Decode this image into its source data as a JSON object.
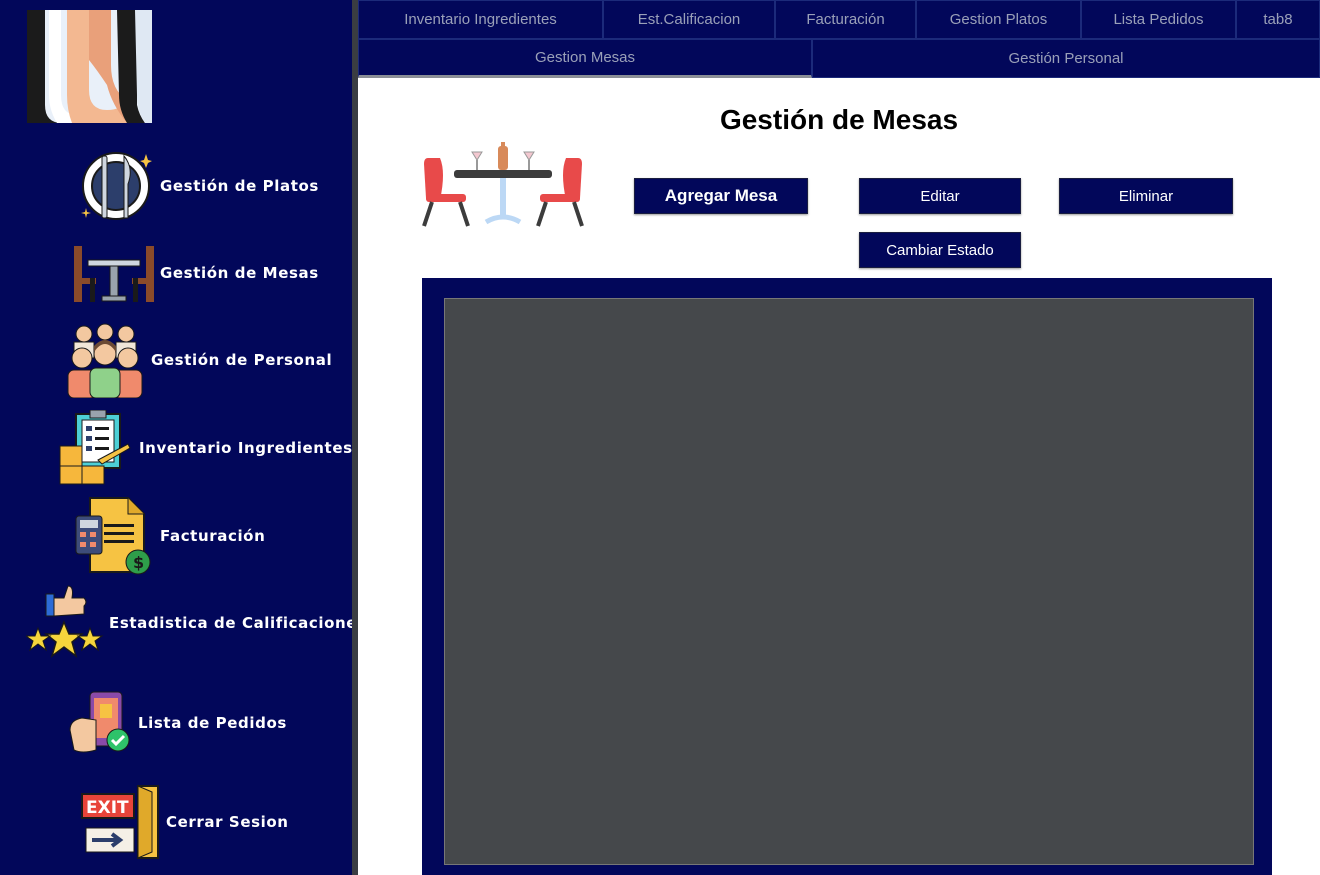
{
  "sidebar": {
    "logo_icon": "hand-logo-icon",
    "items": [
      {
        "label": "Gestión de Platos",
        "icon": "plate-cutlery-icon"
      },
      {
        "label": "Gestión de Mesas",
        "icon": "table-chairs-icon"
      },
      {
        "label": "Gestión de Personal",
        "icon": "staff-group-icon"
      },
      {
        "label": "Inventario Ingredientes",
        "icon": "inventory-clipboard-icon"
      },
      {
        "label": "Facturación",
        "icon": "invoice-calculator-icon"
      },
      {
        "label": "Estadistica de Calificaciones",
        "icon": "thumbs-up-stars-icon"
      },
      {
        "label": "Lista de Pedidos",
        "icon": "phone-order-icon"
      },
      {
        "label": "Cerrar Sesion",
        "icon": "exit-door-icon"
      }
    ]
  },
  "tabs": {
    "row1": [
      "Inventario Ingredientes",
      "Est.Calificacion",
      "Facturación",
      "Gestion Platos",
      "Lista Pedidos",
      "tab8"
    ],
    "row2": [
      "Gestion Mesas",
      "Gestión Personal"
    ],
    "active": "Gestion Mesas"
  },
  "main": {
    "title": "Gestión de Mesas",
    "illustration": "dining-table-icon",
    "buttons": {
      "add": "Agregar Mesa",
      "edit": "Editar",
      "delete": "Eliminar",
      "change_status": "Cambiar Estado"
    }
  },
  "colors": {
    "navy": "#02075a",
    "table_area": "#45484b",
    "divider": "#3a3d42"
  }
}
